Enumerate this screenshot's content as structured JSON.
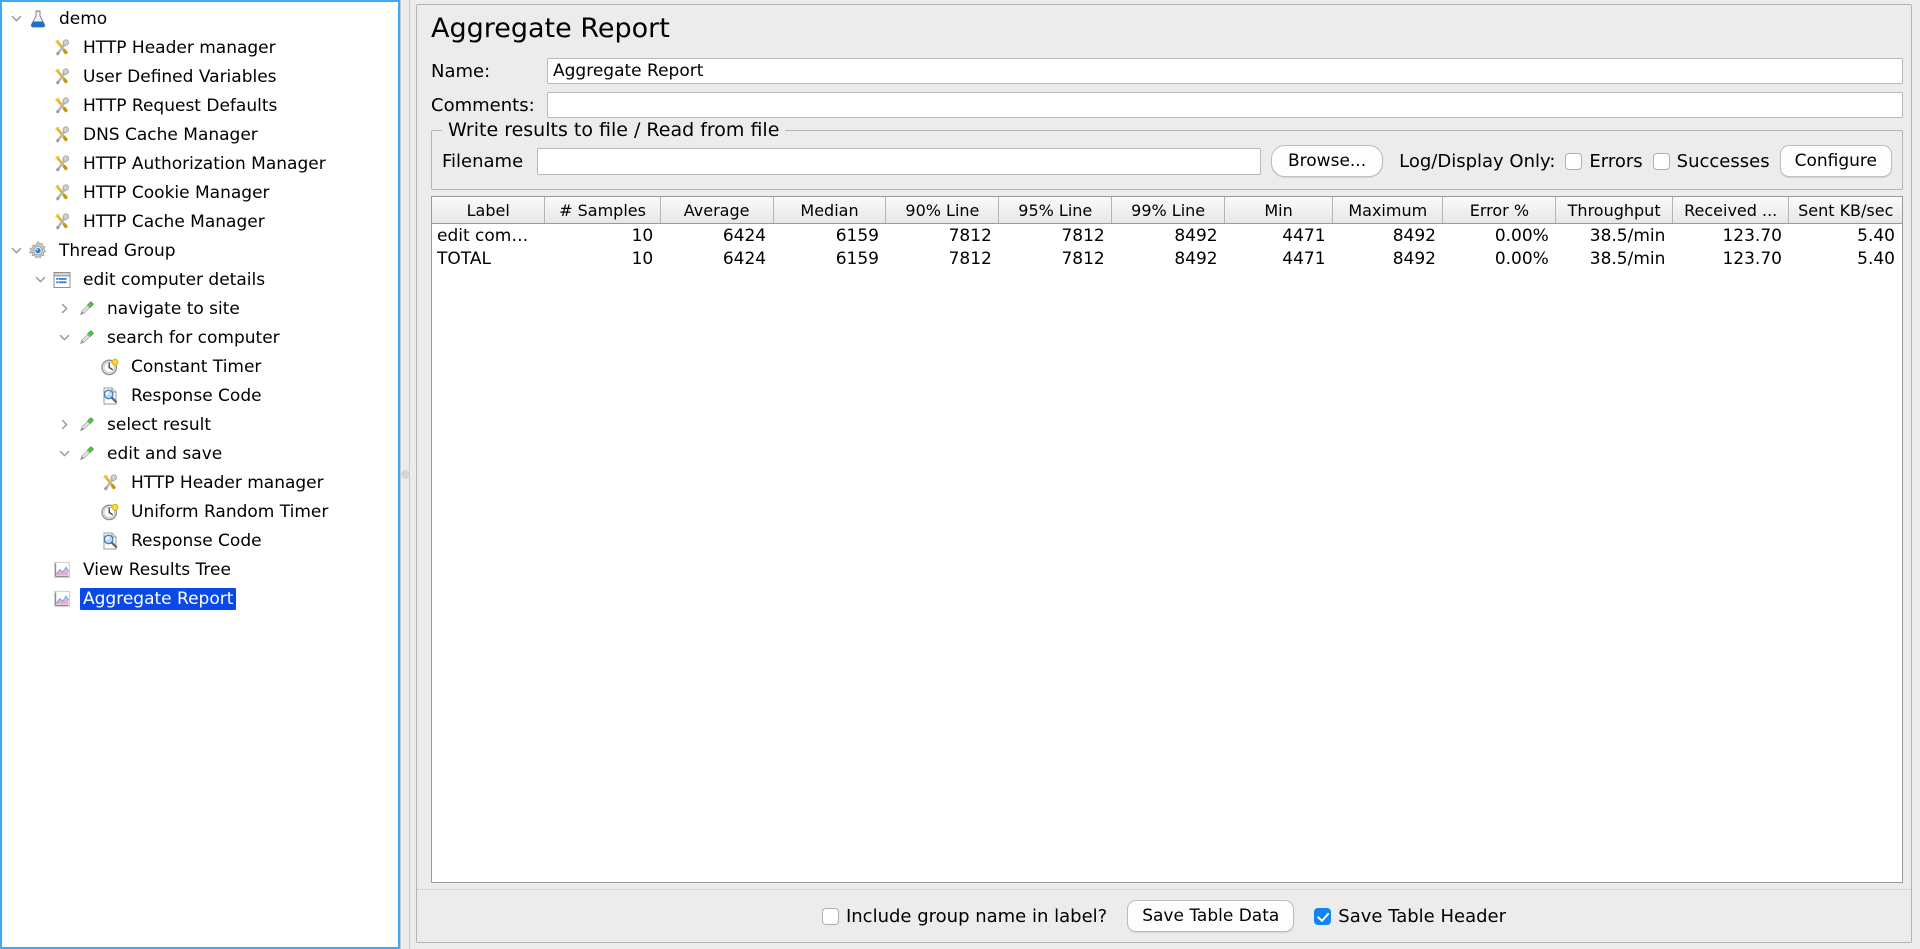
{
  "tree": {
    "nodes": [
      {
        "label": "demo",
        "icon": "test-plan-icon",
        "indent": 0,
        "twisty": "down",
        "selected": false
      },
      {
        "label": "HTTP Header manager",
        "icon": "config-element-icon",
        "indent": 1,
        "twisty": "none",
        "selected": false
      },
      {
        "label": "User Defined Variables",
        "icon": "config-element-icon",
        "indent": 1,
        "twisty": "none",
        "selected": false
      },
      {
        "label": "HTTP Request Defaults",
        "icon": "config-element-icon",
        "indent": 1,
        "twisty": "none",
        "selected": false
      },
      {
        "label": "DNS Cache Manager",
        "icon": "config-element-icon",
        "indent": 1,
        "twisty": "none",
        "selected": false
      },
      {
        "label": "HTTP Authorization Manager",
        "icon": "config-element-icon",
        "indent": 1,
        "twisty": "none",
        "selected": false
      },
      {
        "label": "HTTP Cookie Manager",
        "icon": "config-element-icon",
        "indent": 1,
        "twisty": "none",
        "selected": false
      },
      {
        "label": "HTTP Cache Manager",
        "icon": "config-element-icon",
        "indent": 1,
        "twisty": "none",
        "selected": false
      },
      {
        "label": "Thread Group",
        "icon": "thread-group-icon",
        "indent": 0,
        "twisty": "down",
        "selected": false
      },
      {
        "label": "edit computer details",
        "icon": "transaction-controller-icon",
        "indent": 1,
        "twisty": "down",
        "selected": false
      },
      {
        "label": "navigate to site",
        "icon": "sampler-icon",
        "indent": 2,
        "twisty": "right",
        "selected": false
      },
      {
        "label": "search for computer",
        "icon": "sampler-icon",
        "indent": 2,
        "twisty": "down",
        "selected": false
      },
      {
        "label": "Constant Timer",
        "icon": "timer-icon",
        "indent": 3,
        "twisty": "none",
        "selected": false
      },
      {
        "label": "Response Code",
        "icon": "assertion-icon",
        "indent": 3,
        "twisty": "none",
        "selected": false
      },
      {
        "label": "select result",
        "icon": "sampler-icon",
        "indent": 2,
        "twisty": "right",
        "selected": false
      },
      {
        "label": "edit and save",
        "icon": "sampler-icon",
        "indent": 2,
        "twisty": "down",
        "selected": false
      },
      {
        "label": "HTTP Header manager",
        "icon": "config-element-icon",
        "indent": 3,
        "twisty": "none",
        "selected": false
      },
      {
        "label": "Uniform Random Timer",
        "icon": "timer-icon",
        "indent": 3,
        "twisty": "none",
        "selected": false
      },
      {
        "label": "Response Code",
        "icon": "assertion-icon",
        "indent": 3,
        "twisty": "none",
        "selected": false
      },
      {
        "label": "View Results Tree",
        "icon": "listener-icon",
        "indent": 1,
        "twisty": "none",
        "selected": false
      },
      {
        "label": "Aggregate Report",
        "icon": "listener-icon",
        "indent": 1,
        "twisty": "none",
        "selected": true
      }
    ]
  },
  "panel": {
    "title": "Aggregate Report",
    "name_label": "Name:",
    "name_value": "Aggregate Report",
    "comments_label": "Comments:",
    "comments_value": "",
    "comments_placeholder": ""
  },
  "write_results": {
    "group_title": "Write results to file / Read from file",
    "filename_label": "Filename",
    "filename_value": "",
    "browse_label": "Browse...",
    "logdisplay_label": "Log/Display Only:",
    "errors_label": "Errors",
    "errors_checked": false,
    "successes_label": "Successes",
    "successes_checked": false,
    "configure_label": "Configure"
  },
  "chart_data": {
    "type": "table",
    "title": "Aggregate Report",
    "columns": [
      "Label",
      "# Samples",
      "Average",
      "Median",
      "90% Line",
      "95% Line",
      "99% Line",
      "Min",
      "Maximum",
      "Error %",
      "Throughput",
      "Received ...",
      "Sent KB/sec"
    ],
    "rows": [
      [
        "edit comp...",
        "10",
        "6424",
        "6159",
        "7812",
        "7812",
        "8492",
        "4471",
        "8492",
        "0.00%",
        "38.5/min",
        "123.70",
        "5.40"
      ],
      [
        "TOTAL",
        "10",
        "6424",
        "6159",
        "7812",
        "7812",
        "8492",
        "4471",
        "8492",
        "0.00%",
        "38.5/min",
        "123.70",
        "5.40"
      ]
    ]
  },
  "bottom": {
    "include_group_label": "Include group name in label?",
    "include_group_checked": false,
    "save_table_data_label": "Save Table Data",
    "save_table_header_label": "Save Table Header",
    "save_table_header_checked": true
  }
}
